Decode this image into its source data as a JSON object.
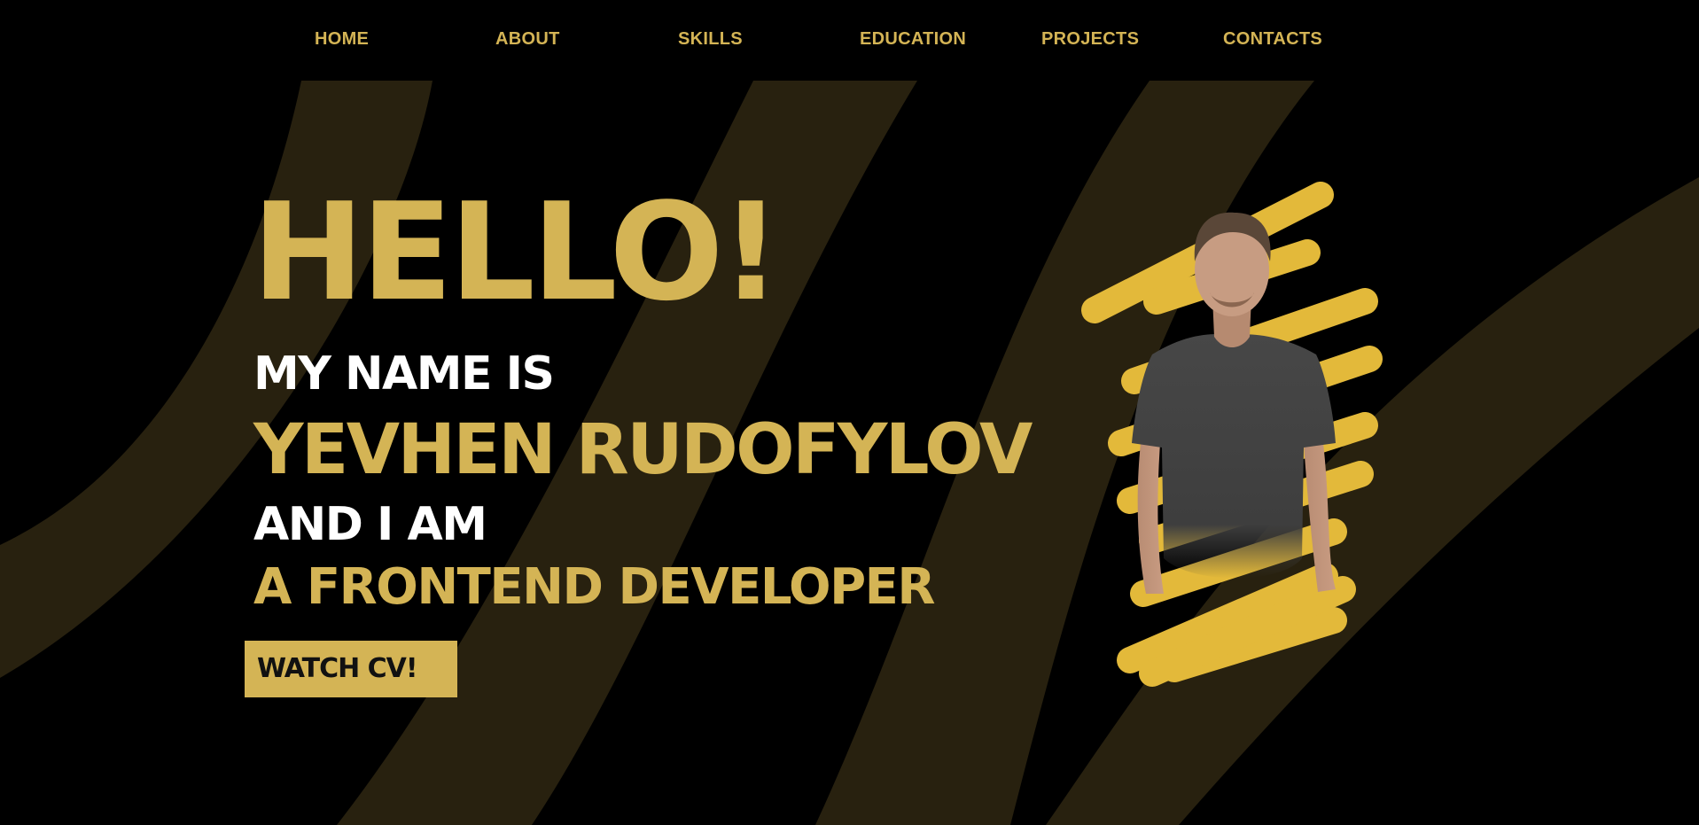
{
  "nav": {
    "items": [
      {
        "label": "HOME"
      },
      {
        "label": "ABOUT"
      },
      {
        "label": "SKILLS"
      },
      {
        "label": "EDUCATION"
      },
      {
        "label": "PROJECTS"
      },
      {
        "label": "CONTACTS"
      }
    ]
  },
  "hero": {
    "greeting": "HELLO!",
    "intro": "MY NAME IS",
    "name": "YEVHEN RUDOFYLOV",
    "and_i_am": "AND I AM",
    "role": "A FRONTEND DEVELOPER",
    "cta_label": "WATCH CV!"
  },
  "colors": {
    "background": "#000000",
    "accent": "#d4b455",
    "stripe": "#28210f",
    "scribble": "#e3b93a",
    "text_light": "#ffffff",
    "button_text": "#111111"
  },
  "icons": {
    "portrait": "portrait-photo",
    "scribble": "yellow-scribble-decoration"
  }
}
